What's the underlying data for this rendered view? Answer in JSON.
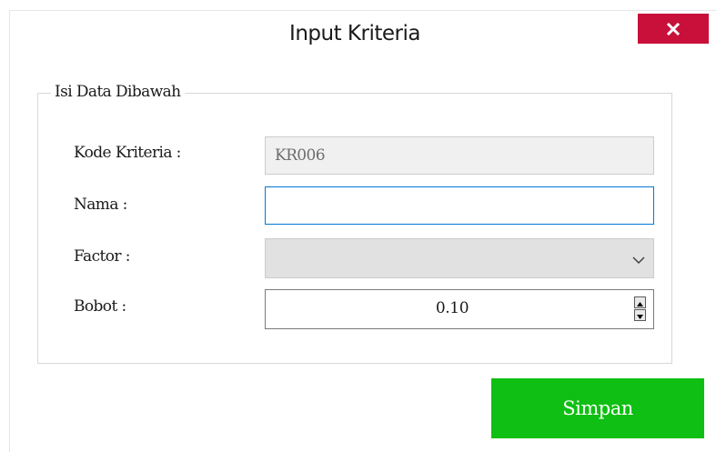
{
  "window": {
    "title": "Input Kriteria",
    "close_icon": "close-icon"
  },
  "group": {
    "legend": "Isi Data Dibawah"
  },
  "fields": {
    "kode": {
      "label": "Kode Kriteria :",
      "value": "KR006"
    },
    "nama": {
      "label": "Nama :",
      "value": "",
      "placeholder": ""
    },
    "factor": {
      "label": "Factor :",
      "selected": "",
      "icon": "chevron-down-icon"
    },
    "bobot": {
      "label": "Bobot :",
      "value": "0.10",
      "icons": [
        "arrow-up-icon",
        "arrow-down-icon"
      ]
    }
  },
  "actions": {
    "save_label": "Simpan"
  },
  "colors": {
    "close": "#c8103a",
    "save": "#0fbf13",
    "focus_border": "#0078d7"
  }
}
